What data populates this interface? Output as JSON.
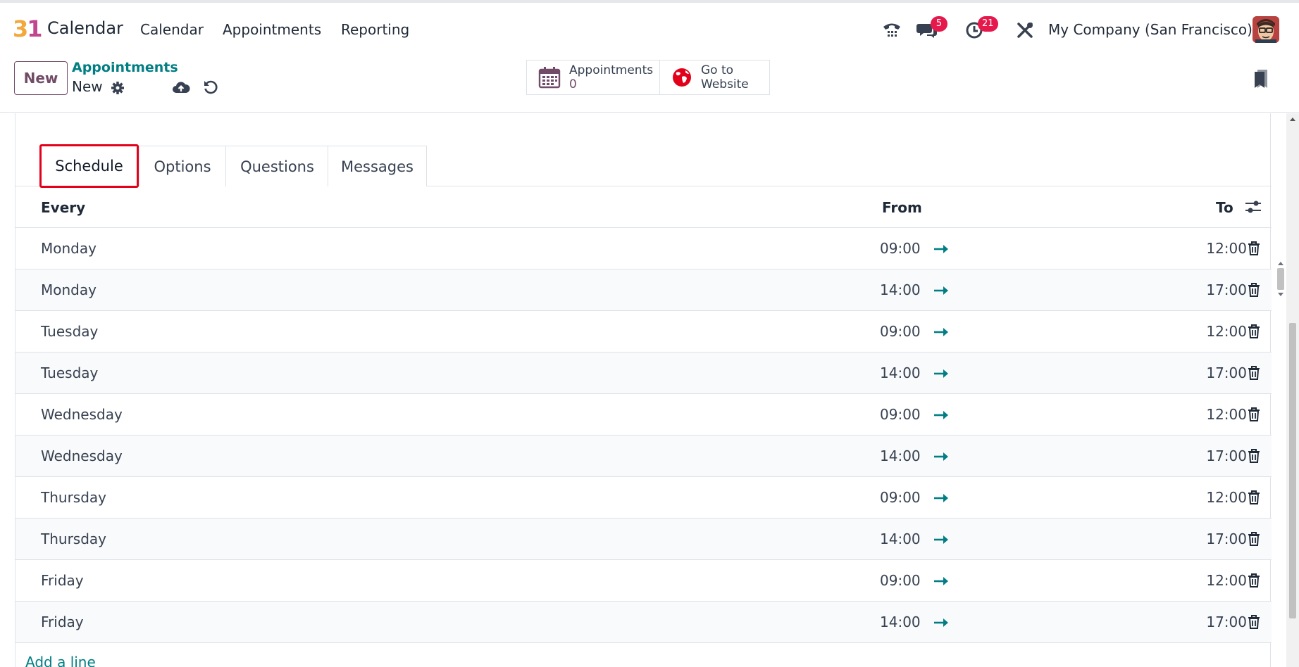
{
  "app": {
    "logo_text_a": "3",
    "logo_text_b": "1",
    "name": "Calendar",
    "menu": [
      "Calendar",
      "Appointments",
      "Reporting"
    ],
    "messages_badge": "5",
    "activities_badge": "21",
    "company": "My Company (San Francisco)"
  },
  "control": {
    "new_label": "New",
    "breadcrumb_parent": "Appointments",
    "breadcrumb_current": "New",
    "smart_appointments_label": "Appointments",
    "smart_appointments_count": "0",
    "smart_website_line1": "Go to",
    "smart_website_line2": "Website"
  },
  "tabs": [
    "Schedule",
    "Options",
    "Questions",
    "Messages"
  ],
  "active_tab": "Schedule",
  "table": {
    "headers": {
      "every": "Every",
      "from": "From",
      "to": "To"
    },
    "rows": [
      {
        "day": "Monday",
        "from": "09:00",
        "to": "12:00"
      },
      {
        "day": "Monday",
        "from": "14:00",
        "to": "17:00"
      },
      {
        "day": "Tuesday",
        "from": "09:00",
        "to": "12:00"
      },
      {
        "day": "Tuesday",
        "from": "14:00",
        "to": "17:00"
      },
      {
        "day": "Wednesday",
        "from": "09:00",
        "to": "12:00"
      },
      {
        "day": "Wednesday",
        "from": "14:00",
        "to": "17:00"
      },
      {
        "day": "Thursday",
        "from": "09:00",
        "to": "12:00"
      },
      {
        "day": "Thursday",
        "from": "14:00",
        "to": "17:00"
      },
      {
        "day": "Friday",
        "from": "09:00",
        "to": "12:00"
      },
      {
        "day": "Friday",
        "from": "14:00",
        "to": "17:00"
      }
    ],
    "add_line": "Add a line"
  },
  "colors": {
    "brand": "#714b67",
    "accent": "#017e84",
    "badge": "#e5194b",
    "highlight": "#e3001b"
  },
  "icons": {
    "phone": "phone-icon",
    "messages": "chat-icon",
    "activities": "clock-icon",
    "settings": "tools-icon",
    "gear": "gear-icon",
    "save": "cloud-upload-icon",
    "discard": "undo-icon",
    "calendar": "calendar-icon",
    "globe": "globe-icon",
    "bookmark": "bookmark-icon",
    "arrow": "arrow-right-icon",
    "trash": "trash-icon",
    "column_settings": "sliders-icon"
  }
}
